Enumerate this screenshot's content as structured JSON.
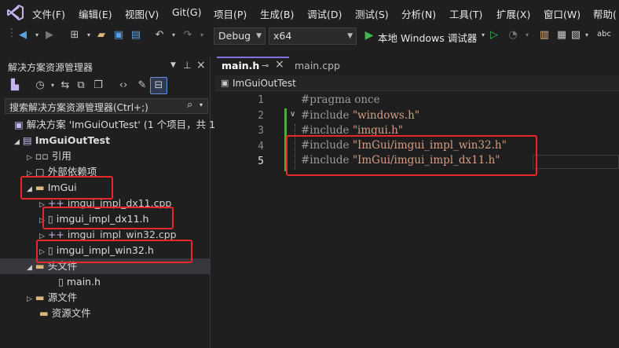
{
  "menu": [
    "文件(F)",
    "编辑(E)",
    "视图(V)",
    "Git(G)",
    "项目(P)",
    "生成(B)",
    "调试(D)",
    "测试(S)",
    "分析(N)",
    "工具(T)",
    "扩展(X)",
    "窗口(W)",
    "帮助("
  ],
  "toolbar": {
    "config": "Debug",
    "platform": "x64",
    "run_label": "本地 Windows 调试器",
    "spell": "abc"
  },
  "solution_explorer": {
    "title": "解决方案资源管理器",
    "search_placeholder": "搜索解决方案资源管理器(Ctrl+;)",
    "solution": "解决方案 'ImGuiOutTest' (1 个项目，共 1",
    "project": "ImGuiOutTest",
    "references": "引用",
    "external_deps": "外部依赖项",
    "folder_imgui": "ImGui",
    "file1": "imgui_impl_dx11.cpp",
    "file2": "imgui_impl_dx11.h",
    "file3": "imgui_impl_win32.cpp",
    "file4": "imgui_impl_win32.h",
    "headers": "头文件",
    "main_h": "main.h",
    "sources": "源文件",
    "resources": "资源文件"
  },
  "editor": {
    "tabs": [
      {
        "label": "main.h",
        "active": true,
        "pin": "⊸",
        "close": "×"
      },
      {
        "label": "main.cpp",
        "active": false
      }
    ],
    "nav_project": "ImGuiOutTest",
    "lines": [
      {
        "num": "1",
        "kw": "#pragma once",
        "str": ""
      },
      {
        "num": "2",
        "kw": "#include ",
        "str": "\"windows.h\""
      },
      {
        "num": "3",
        "kw": "#include ",
        "str": "\"imgui.h\""
      },
      {
        "num": "4",
        "kw": "#include ",
        "str": "\"ImGui/imgui_impl_win32.h\""
      },
      {
        "num": "5",
        "kw": "#include ",
        "str": "\"ImGui/imgui_impl_dx11.h\""
      }
    ]
  },
  "colors": {
    "highlight_box": "#e8272a",
    "change_bar": "#57a64a",
    "active_tab": "#8a6fe0"
  }
}
